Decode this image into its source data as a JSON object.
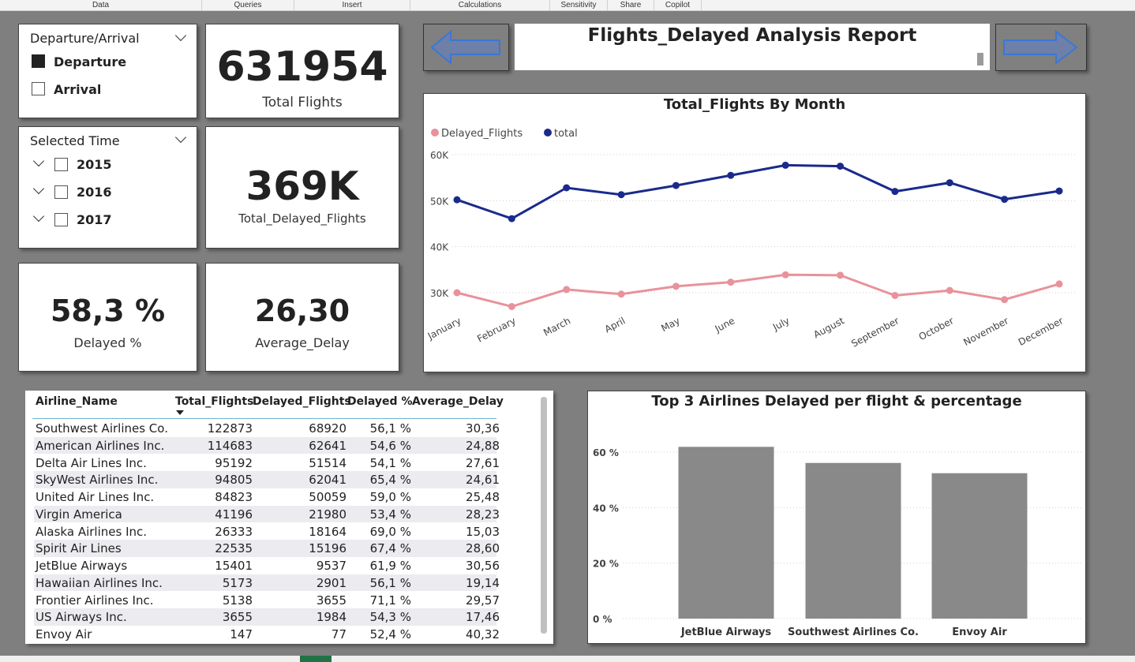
{
  "ribbon": {
    "groups": [
      "Data",
      "Queries",
      "Insert",
      "Calculations",
      "Sensitivity",
      "Share",
      "Copilot"
    ]
  },
  "slicer_direction": {
    "title": "Departure/Arrival",
    "options": [
      {
        "label": "Departure",
        "checked": true
      },
      {
        "label": "Arrival",
        "checked": false
      }
    ]
  },
  "slicer_time": {
    "title": "Selected Time",
    "years": [
      "2015",
      "2016",
      "2017"
    ]
  },
  "kpis": {
    "total_flights": {
      "value": "631954",
      "label": "Total Flights"
    },
    "total_delayed": {
      "value": "369K",
      "label": "Total_Delayed_Flights"
    },
    "delayed_pct": {
      "value": "58,3 %",
      "label": "Delayed %"
    },
    "avg_delay": {
      "value": "26,30",
      "label": "Average_Delay"
    }
  },
  "header": {
    "title": "Flights_Delayed Analysis Report",
    "prev_icon": "left-arrow-icon",
    "next_icon": "right-arrow-icon"
  },
  "colors": {
    "total_series": "#1a2a8c",
    "delayed_series": "#e8929b",
    "bars": "#898989",
    "page_bg": "#7f7f7f",
    "arrow_fill": "#6e7fa8",
    "arrow_stroke": "#3b77d6"
  },
  "line_chart": {
    "title": "Total_Flights By Month",
    "chart_data": {
      "type": "line",
      "categories": [
        "January",
        "February",
        "March",
        "April",
        "May",
        "June",
        "July",
        "August",
        "September",
        "October",
        "November",
        "December"
      ],
      "series": [
        {
          "name": "Delayed_Flights",
          "values": [
            30000,
            27000,
            30700,
            29700,
            31400,
            32300,
            33900,
            33800,
            29400,
            30500,
            28500,
            31900
          ]
        },
        {
          "name": "total",
          "values": [
            50200,
            46100,
            52800,
            51300,
            53300,
            55500,
            57700,
            57500,
            52000,
            53900,
            50300,
            52100
          ]
        }
      ],
      "y_ticks": [
        "30K",
        "40K",
        "50K",
        "60K"
      ],
      "ylim": [
        30000,
        60000
      ],
      "legend": "top-left",
      "grid": true
    }
  },
  "table": {
    "columns": [
      "Airline_Name",
      "Total_Flights",
      "Delayed_Flights",
      "Delayed %",
      "Average_Delay"
    ],
    "sorted_column": "Total_Flights",
    "rows": [
      [
        "Southwest Airlines Co.",
        "122873",
        "68920",
        "56,1 %",
        "30,36"
      ],
      [
        "American Airlines Inc.",
        "114683",
        "62641",
        "54,6 %",
        "24,88"
      ],
      [
        "Delta Air Lines Inc.",
        "95192",
        "51514",
        "54,1 %",
        "27,61"
      ],
      [
        "SkyWest Airlines Inc.",
        "94805",
        "62041",
        "65,4 %",
        "24,61"
      ],
      [
        "United Air Lines Inc.",
        "84823",
        "50059",
        "59,0 %",
        "25,48"
      ],
      [
        "Virgin America",
        "41196",
        "21980",
        "53,4 %",
        "28,23"
      ],
      [
        "Alaska Airlines Inc.",
        "26333",
        "18164",
        "69,0 %",
        "15,03"
      ],
      [
        "Spirit Air Lines",
        "22535",
        "15196",
        "67,4 %",
        "28,60"
      ],
      [
        "JetBlue Airways",
        "15401",
        "9537",
        "61,9 %",
        "30,56"
      ],
      [
        "Hawaiian Airlines Inc.",
        "5173",
        "2901",
        "56,1 %",
        "19,14"
      ],
      [
        "Frontier Airlines Inc.",
        "5138",
        "3655",
        "71,1 %",
        "29,57"
      ],
      [
        "US Airways Inc.",
        "3655",
        "1984",
        "54,3 %",
        "17,46"
      ],
      [
        "Envoy Air",
        "147",
        "77",
        "52,4 %",
        "40,32"
      ]
    ]
  },
  "bar_chart": {
    "title": "Top 3 Airlines Delayed per flight & percentage",
    "chart_data": {
      "type": "bar",
      "categories": [
        "JetBlue Airways",
        "Southwest Airlines Co.",
        "Envoy Air"
      ],
      "values": [
        61.9,
        56.1,
        52.4
      ],
      "y_ticks": [
        "0 %",
        "20 %",
        "40 %",
        "60 %"
      ],
      "ylim": [
        0,
        60
      ],
      "grid": true
    }
  }
}
